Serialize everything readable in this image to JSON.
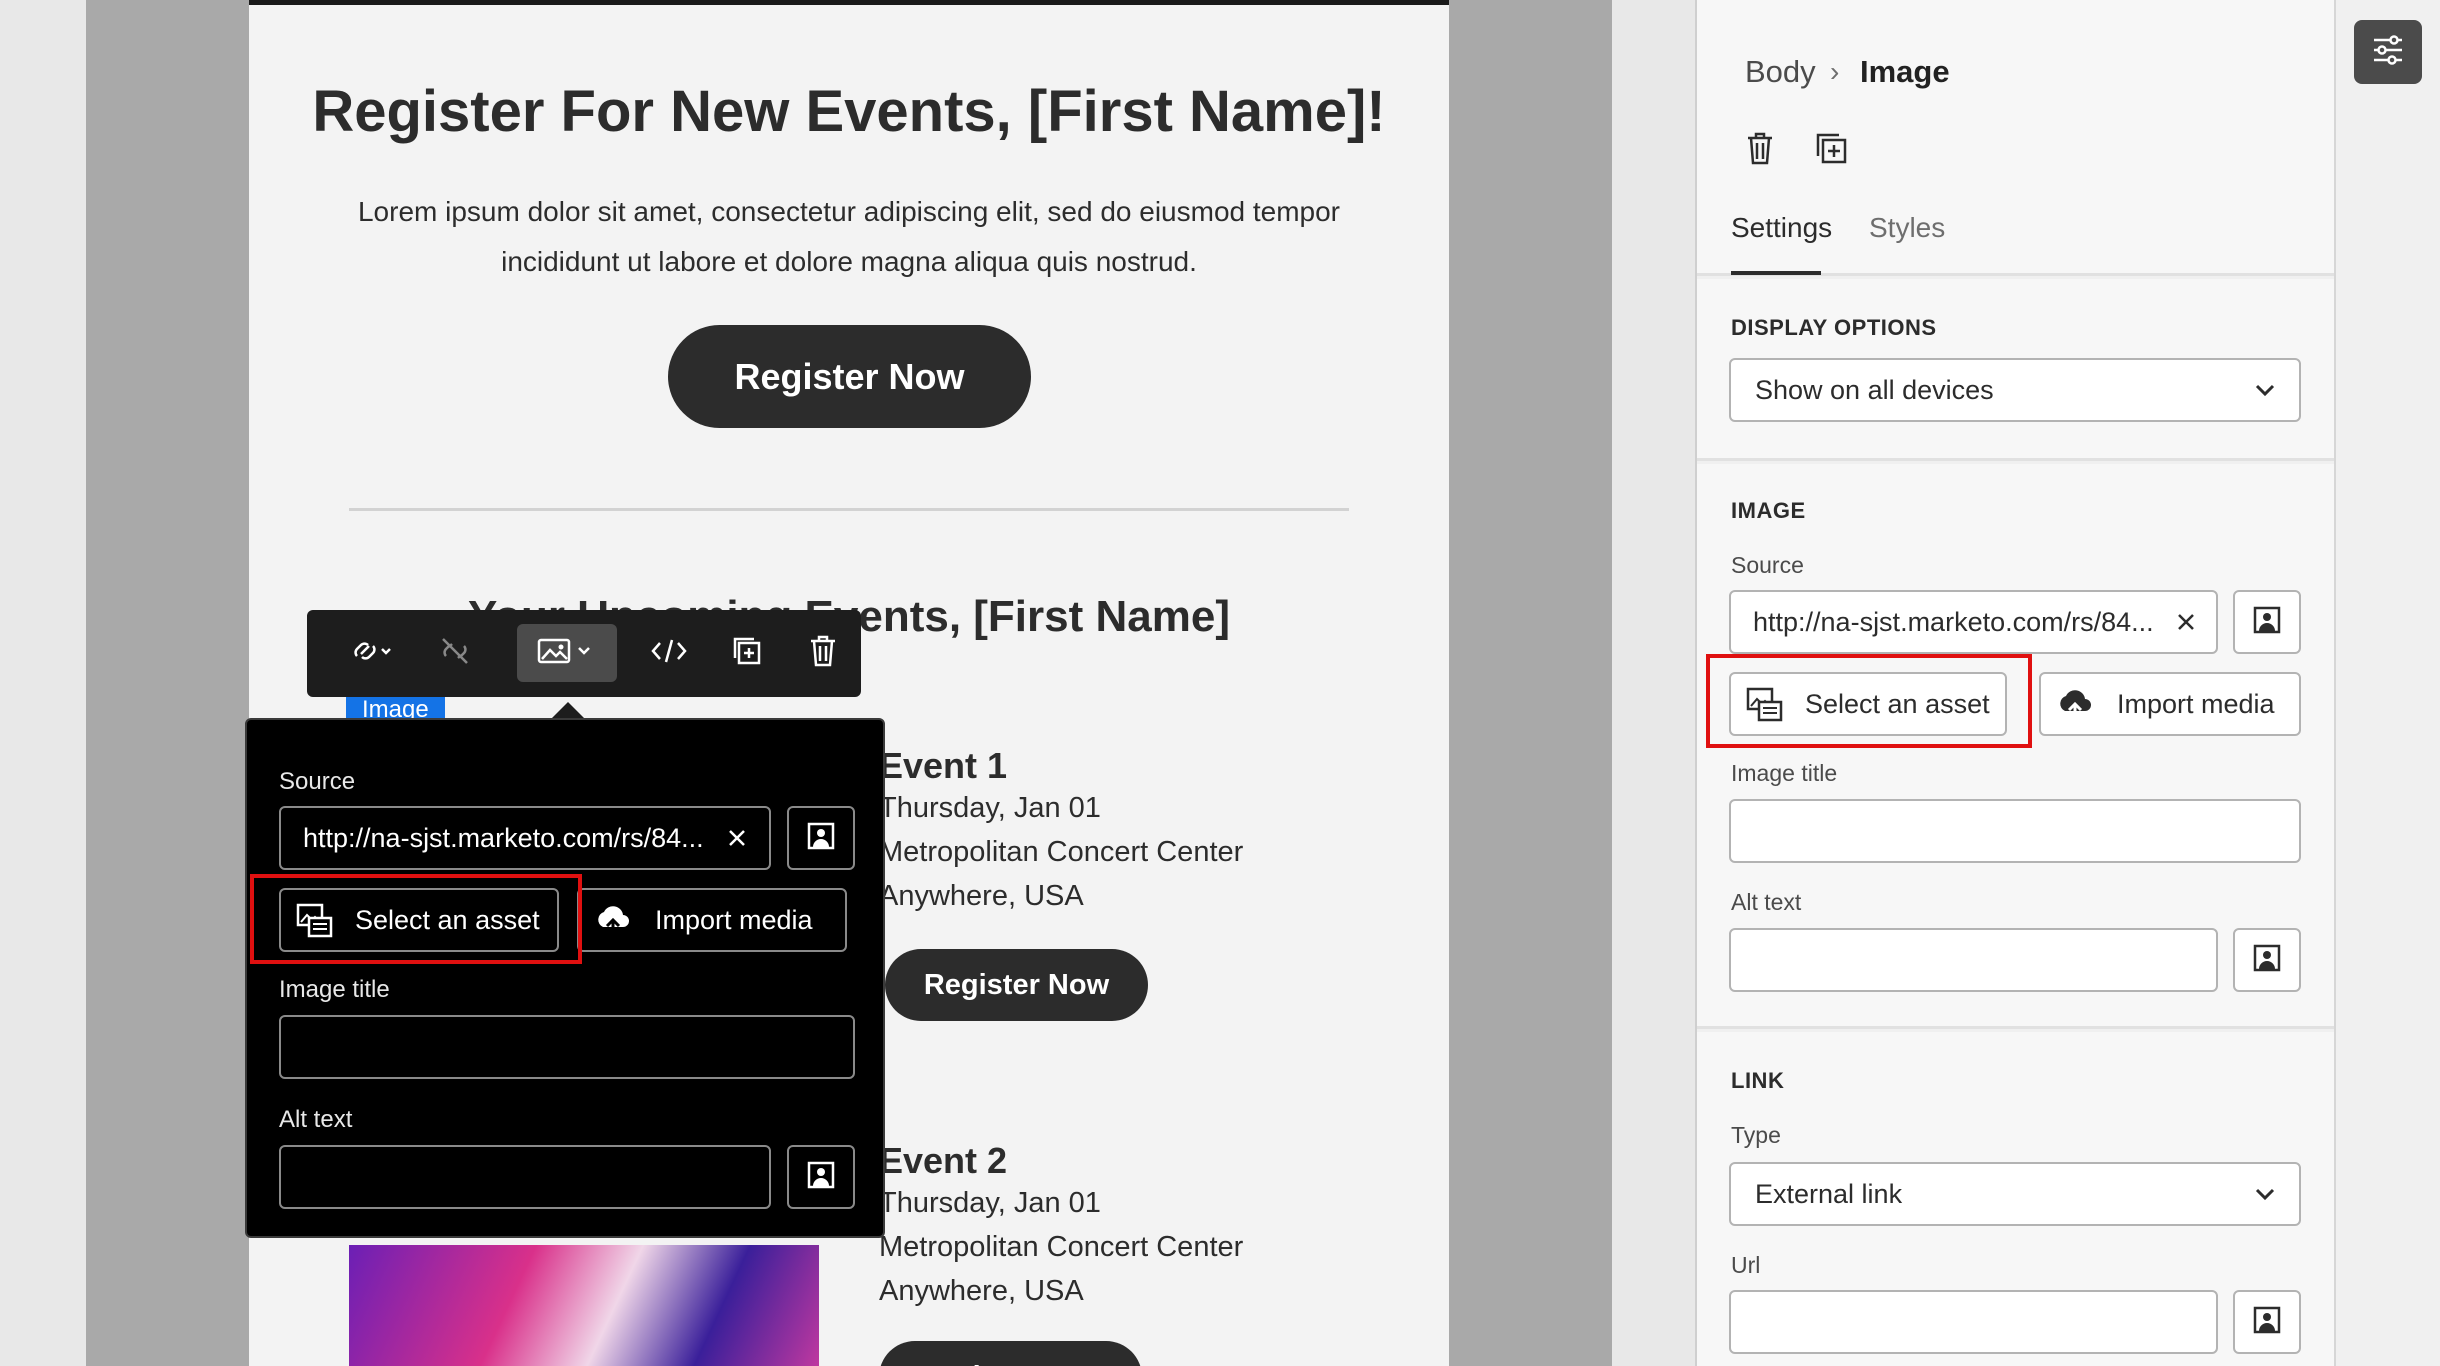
{
  "email": {
    "hero_title": "Register For New Events, [First Name]!",
    "hero_body": "Lorem ipsum dolor sit amet, consectetur adipiscing elit, sed do eiusmod tempor incididunt ut labore et dolore magna aliqua quis nostrud.",
    "register_label": "Register Now",
    "events_title": "Your Upcoming Events, [First Name]",
    "image_block_label": "Image",
    "events": [
      {
        "title": "Event 1",
        "date": "Thursday, Jan 01",
        "venue": "Metropolitan Concert Center",
        "location": "Anywhere, USA",
        "button": "Register Now"
      },
      {
        "title": "Event 2",
        "date": "Thursday, Jan 01",
        "venue": "Metropolitan Concert Center",
        "location": "Anywhere, USA",
        "button": "Register Now"
      }
    ]
  },
  "toolbar": {
    "icons": [
      "link-icon",
      "unlink-icon",
      "image-icon",
      "code-icon",
      "duplicate-icon",
      "trash-icon"
    ]
  },
  "popover": {
    "source_label": "Source",
    "source_value": "http://na-sjst.marketo.com/rs/84...",
    "select_asset": "Select an asset",
    "import_media": "Import media",
    "image_title_label": "Image title",
    "alt_text_label": "Alt text"
  },
  "panel": {
    "breadcrumb": {
      "parent": "Body",
      "separator": "›",
      "current": "Image"
    },
    "tabs": {
      "settings": "Settings",
      "styles": "Styles"
    },
    "display_options": {
      "title": "DISPLAY OPTIONS",
      "value": "Show on all devices"
    },
    "image": {
      "title": "IMAGE",
      "source_label": "Source",
      "source_value": "http://na-sjst.marketo.com/rs/84...",
      "select_asset": "Select an asset",
      "import_media": "Import media",
      "image_title_label": "Image title",
      "alt_text_label": "Alt text"
    },
    "link": {
      "title": "LINK",
      "type_label": "Type",
      "type_value": "External link",
      "url_label": "Url"
    }
  },
  "colors": {
    "highlight": "#e01010",
    "selection": "#1473e6",
    "dark": "#2c2c2c"
  }
}
